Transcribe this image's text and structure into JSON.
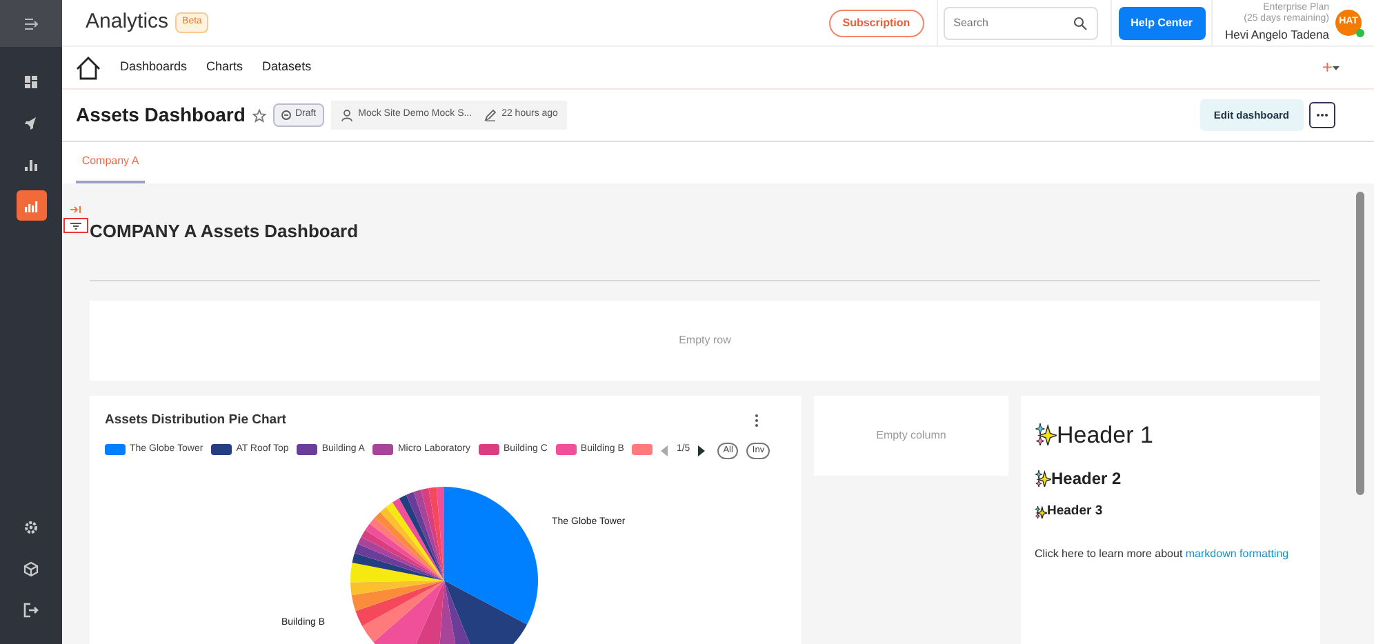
{
  "sidebar": {
    "items": [
      {
        "selected": false
      },
      {
        "selected": false
      },
      {
        "selected": false
      },
      {
        "selected": true
      }
    ]
  },
  "header": {
    "app_title": "Analytics",
    "badge": "Beta",
    "subscription": "Subscription",
    "search": {
      "placeholder": "Search"
    },
    "help": "Help Center",
    "plan": "Enterprise Plan",
    "plan_note": "(25 days remaining)",
    "user": "Hevi Angelo Tadena",
    "avatar": "HAT",
    "online": true
  },
  "nav": {
    "links": [
      "Dashboards",
      "Charts",
      "Datasets"
    ],
    "add": "+"
  },
  "title_bar": {
    "title": "Assets Dashboard",
    "favorite": false,
    "status": "Draft",
    "owner": "Mock Site Demo Mock S...",
    "modified": "22 hours ago",
    "edit": "Edit dashboard"
  },
  "tabs": [
    {
      "label": "Company A",
      "selected": true
    }
  ],
  "dashboard": {
    "heading": "COMPANY A Assets Dashboard",
    "empty_row": "Empty row",
    "empty_column": "Empty column",
    "pie_chart": {
      "title": "Assets Distribution Pie Chart",
      "legend": [
        {
          "label": "The Globe Tower",
          "color": "#0080ff"
        },
        {
          "label": "AT Roof Top",
          "color": "#233f80"
        },
        {
          "label": "Building A",
          "color": "#6a3d99"
        },
        {
          "label": "Micro Laboratory",
          "color": "#a8449a"
        },
        {
          "label": "Building C",
          "color": "#d93f80"
        },
        {
          "label": "Building B",
          "color": "#f0509a"
        },
        {
          "color": "#ff7a7a"
        }
      ],
      "pager": "1/5",
      "all": "All",
      "inv": "Inv",
      "slice_labels": [
        "The Globe Tower",
        "Building B"
      ]
    },
    "markdown": {
      "headers": [
        "Header 1",
        "Header 2",
        "Header 3"
      ],
      "text": "Click here to learn more about",
      "link": "markdown formatting"
    }
  }
}
